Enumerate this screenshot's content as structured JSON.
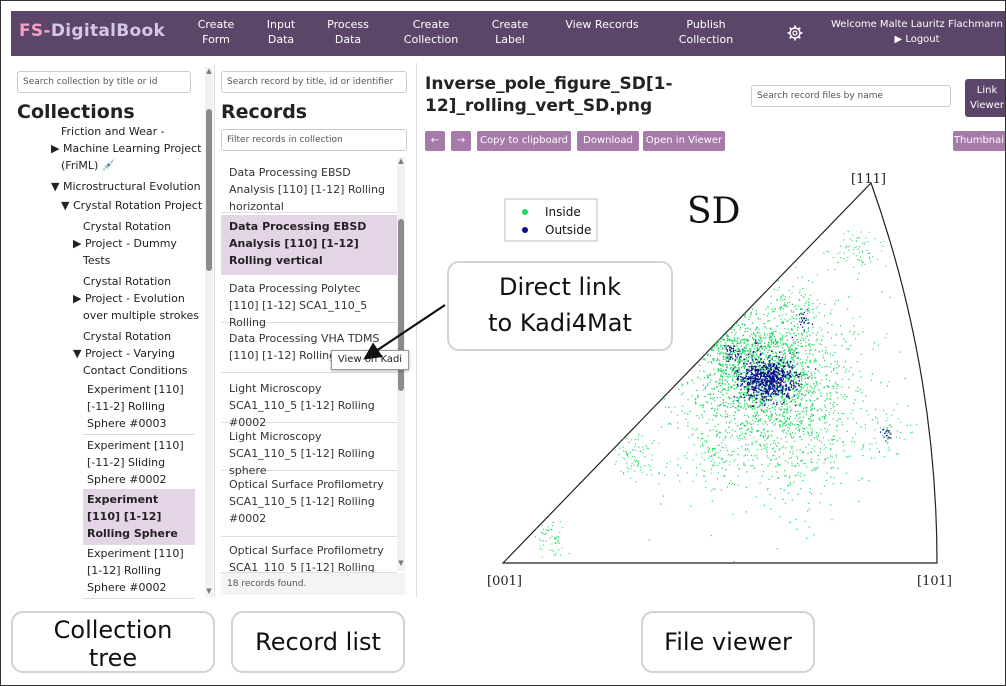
{
  "nav": {
    "logo_prefix": "FS-",
    "logo_main": "DigitalBook",
    "items": [
      {
        "label": "Create\nForm"
      },
      {
        "label": "Input\nData"
      },
      {
        "label": "Process\nData"
      },
      {
        "label": "Create\nCollection"
      },
      {
        "label": "Create\nLabel"
      },
      {
        "label": "View Records"
      },
      {
        "label": "Publish\nCollection"
      }
    ],
    "settings_icon": "gear-icon",
    "welcome": "Welcome Malte Lauritz Flachmann",
    "logout": "▶ Logout"
  },
  "collections": {
    "search_placeholder": "Search collection by title or id",
    "heading": "Collections",
    "tree": [
      {
        "text": "Friction and Wear -"
      },
      {
        "text": "▶ Machine Learning Project"
      },
      {
        "text": "(FriML) 💉"
      },
      {
        "text": "▼ Microstructural Evolution"
      },
      {
        "text": "▼ Crystal Rotation Project"
      },
      {
        "text": "Crystal Rotation"
      },
      {
        "text": "▶ Project - Dummy"
      },
      {
        "text": "Tests"
      },
      {
        "text": "Crystal Rotation"
      },
      {
        "text": "▶ Project - Evolution"
      },
      {
        "text": "over multiple strokes"
      },
      {
        "text": "Crystal Rotation"
      },
      {
        "text": "▼ Project - Varying"
      },
      {
        "text": "Contact Conditions"
      }
    ],
    "experiments": [
      {
        "label": "Experiment [110] [-11-2] Rolling Sphere #0003"
      },
      {
        "label": "Experiment [110] [-11-2] Sliding Sphere #0002"
      },
      {
        "label": "Experiment [110] [1-12] Rolling Sphere"
      },
      {
        "label": "Experiment [110] [1-12] Rolling Sphere #0002"
      }
    ]
  },
  "records": {
    "search_placeholder": "Search record by title, id or identifier",
    "heading": "Records",
    "filter_placeholder": "Filter records in collection",
    "items": [
      {
        "label": "Data Processing EBSD Analysis [110] [1-12] Rolling horizontal"
      },
      {
        "label": "Data Processing EBSD Analysis [110] [1-12] Rolling vertical"
      },
      {
        "label": "Data Processing Polytec [110] [1-12] SCA1_110_5 Rolling"
      },
      {
        "label": "Data Processing VHA TDMS [110] [1-12] Rolling"
      },
      {
        "label": "Light Microscopy SCA1_110_5 [1-12] Rolling #0002"
      },
      {
        "label": "Light Microscopy SCA1_110_5 [1-12] Rolling sphere"
      },
      {
        "label": "Optical Surface Profilometry SCA1_110_5 [1-12] Rolling #0002"
      },
      {
        "label": "Optical Surface Profilometry SCA1_110_5 [1-12] Rolling"
      }
    ],
    "tooltip": "View on Kadi",
    "count_text": "18 records found."
  },
  "viewer": {
    "file_title": "Inverse_pole_figure_SD[1-12]_rolling_vert_SD.png",
    "search_placeholder": "Search record files by name",
    "link_viewer": "Link\nViewer",
    "buttons": {
      "prev": "←",
      "next": "→",
      "copy": "Copy to clipboard",
      "download": "Download",
      "open": "Open in Viewer",
      "thumbnails": "Thumbnails"
    },
    "figure": {
      "title": "SD",
      "corner_001": "[001]",
      "corner_101": "[101]",
      "corner_111": "[111]",
      "legend": [
        {
          "label": "Inside",
          "color": "#1ed760"
        },
        {
          "label": "Outside",
          "color": "#0a0a8c"
        }
      ]
    }
  },
  "callouts": {
    "direct_link": "Direct link\nto Kadi4Mat",
    "collection_tree": "Collection\ntree",
    "record_list": "Record list",
    "file_viewer": "File viewer"
  },
  "colors": {
    "nav_bg": "#5b4569",
    "button": "#a67aa9",
    "selected": "#e4d5e6"
  }
}
